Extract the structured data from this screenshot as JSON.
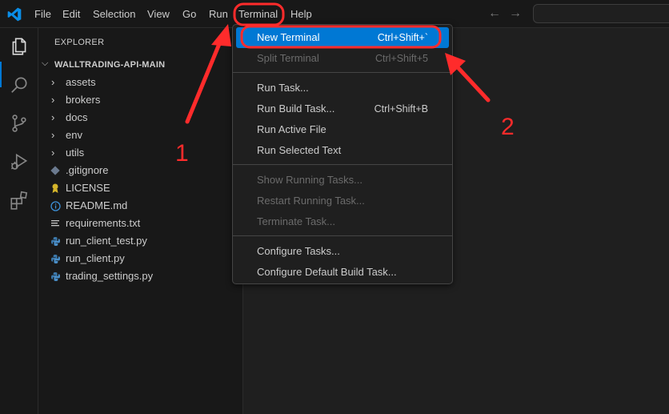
{
  "menubar": {
    "items": [
      "File",
      "Edit",
      "Selection",
      "View",
      "Go",
      "Run",
      "Terminal",
      "Help"
    ],
    "active": "Terminal"
  },
  "icons": {
    "app": "vscode-logo-icon",
    "back": "arrow-left-icon",
    "forward": "arrow-right-icon",
    "activity": [
      "explorer-icon",
      "search-icon",
      "source-control-icon",
      "run-debug-icon",
      "extensions-icon"
    ]
  },
  "colors": {
    "accent": "#0078d4",
    "annotation": "#ff2b2b"
  },
  "sidebar": {
    "title": "EXPLORER",
    "more": "…",
    "folder": "WALLTRADING-API-MAIN",
    "folders": [
      "assets",
      "brokers",
      "docs",
      "env",
      "utils"
    ],
    "files": [
      {
        "label": ".gitignore",
        "icon": "git-icon"
      },
      {
        "label": "LICENSE",
        "icon": "license-icon"
      },
      {
        "label": "README.md",
        "icon": "info-icon"
      },
      {
        "label": "requirements.txt",
        "icon": "text-file-icon"
      },
      {
        "label": "run_client_test.py",
        "icon": "python-icon"
      },
      {
        "label": "run_client.py",
        "icon": "python-icon"
      },
      {
        "label": "trading_settings.py",
        "icon": "python-icon"
      }
    ]
  },
  "terminal_menu": {
    "groups": [
      [
        {
          "label": "New Terminal",
          "shortcut": "Ctrl+Shift+`",
          "disabled": false,
          "highlighted": true
        },
        {
          "label": "Split Terminal",
          "shortcut": "Ctrl+Shift+5",
          "disabled": true
        }
      ],
      [
        {
          "label": "Run Task...",
          "shortcut": "",
          "disabled": false
        },
        {
          "label": "Run Build Task...",
          "shortcut": "Ctrl+Shift+B",
          "disabled": false
        },
        {
          "label": "Run Active File",
          "shortcut": "",
          "disabled": false
        },
        {
          "label": "Run Selected Text",
          "shortcut": "",
          "disabled": false
        }
      ],
      [
        {
          "label": "Show Running Tasks...",
          "shortcut": "",
          "disabled": true
        },
        {
          "label": "Restart Running Task...",
          "shortcut": "",
          "disabled": true
        },
        {
          "label": "Terminate Task...",
          "shortcut": "",
          "disabled": true
        }
      ],
      [
        {
          "label": "Configure Tasks...",
          "shortcut": "",
          "disabled": false
        },
        {
          "label": "Configure Default Build Task...",
          "shortcut": "",
          "disabled": false
        }
      ]
    ]
  },
  "annotations": {
    "step1": "1",
    "step2": "2"
  }
}
